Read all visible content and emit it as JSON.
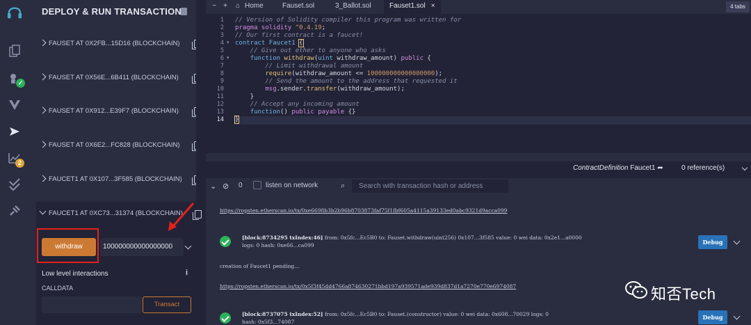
{
  "rail": {
    "icons": [
      "remix-logo-icon",
      "file-explorer-icon",
      "compiler-icon",
      "vyper-icon",
      "deploy-run-icon",
      "analysis-icon",
      "testing-icon",
      "plugin-manager-icon"
    ],
    "analysis_badge": "2",
    "badge_color": "#e0a33a",
    "check_color": "#2bb35a"
  },
  "panel": {
    "title": "DEPLOY & RUN TRANSACTIONS",
    "instances": [
      "FAUSET AT 0X2FB...15D16 (BLOCKCHAIN)",
      "FAUSET AT 0X56E...6B411 (BLOCKCHAIN)",
      "FAUSET AT 0X912...E39F7 (BLOCKCHAIN)",
      "FAUSET AT 0X6E2...FC828 (BLOCKCHAIN)",
      "FAUCET1 AT 0X107...3F585 (BLOCKCHAIN)"
    ],
    "expanded_instance": "FAUCET1 AT 0XC73...31374 (BLOCKCHAIN)",
    "withdraw_label": "withdraw",
    "withdraw_value": "100000000000000000",
    "low_level_label": "Low level interactions",
    "calldata_label": "CALLDATA",
    "transact_label": "Transact",
    "info_icon": "i"
  },
  "tabs": {
    "home": "Home",
    "items": [
      "Fauset.sol",
      "3_Ballot.sol",
      "Fauset1.sol"
    ],
    "close": "×",
    "count": "4 tabs"
  },
  "editor": {
    "line_numbers": [
      "1",
      "2",
      "3",
      "4",
      "5",
      "6",
      "7",
      "8",
      "9",
      "10",
      "11",
      "12",
      "13",
      "14"
    ],
    "active_line": "14"
  },
  "definition": {
    "label": "ContractDefinition",
    "name": "Faucet1",
    "references": "0 reference(s)"
  },
  "terminal": {
    "count": "0",
    "listen_label": "listen on network",
    "search_placeholder": "Search with transaction hash or address",
    "link1": "https://ropsten.etherscan.io/tx/0xe6698b3b2b96b8703873faf75f1fbf605a4115a39133ed0abc9321d9acca099",
    "log1_block": "[block:8734295 txIndex:46]",
    "log1_line1": "from: 0x5fc...Ec5B0 to: Fauset.withdraw(uint256) 0x107...3f585 value: 0 wei data: 0x2e1...a0000",
    "log1_line2": "logs: 0 hash: 0xe66...ca099",
    "pending": "creation of Faucet1 pending...",
    "link2": "https://ropsten.etherscan.io/tx/0x5f3f45dd4766a874630271bbd197a939571ade939d837d1a7270e770e6974087",
    "log2_block": "[block:8737075 txIndex:52]",
    "log2_line1": "from: 0x5fc...Ec5B0 to: Fauset.(constructor) value: 0 wei data: 0x608...70029 logs: 0",
    "log2_line2": "hash: 0x5f3...74087",
    "debug_label": "Debug"
  },
  "watermark": {
    "text": "知否Tech"
  }
}
